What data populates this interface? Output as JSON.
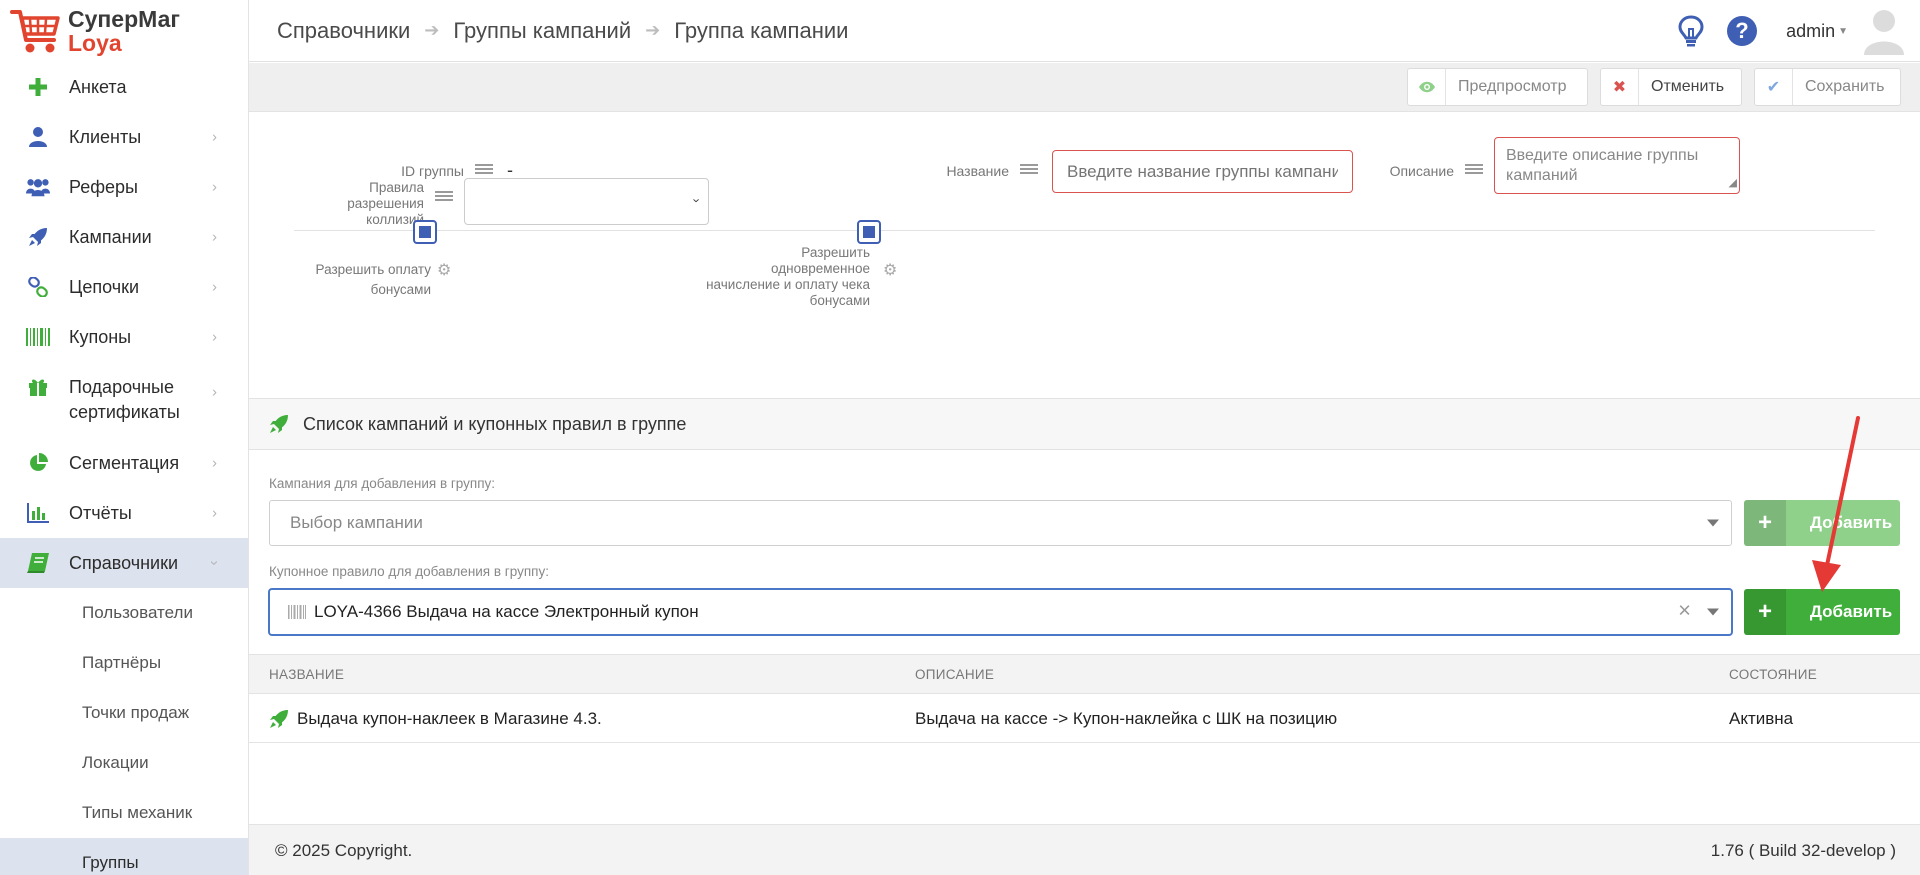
{
  "app": {
    "title": "СуперМаг",
    "subtitle": "Loya"
  },
  "sidebar": {
    "items": [
      {
        "label": "Анкета",
        "icon": "plus-icon"
      },
      {
        "label": "Клиенты",
        "icon": "user-icon"
      },
      {
        "label": "Реферы",
        "icon": "users-icon"
      },
      {
        "label": "Кампании",
        "icon": "rocket-icon"
      },
      {
        "label": "Цепочки",
        "icon": "link-icon"
      },
      {
        "label": "Купоны",
        "icon": "barcode-icon"
      },
      {
        "label": "Подарочные сертификаты",
        "icon": "gift-icon"
      },
      {
        "label": "Сегментация",
        "icon": "pie-chart-icon"
      },
      {
        "label": "Отчёты",
        "icon": "bar-chart-icon"
      },
      {
        "label": "Справочники",
        "icon": "book-icon"
      }
    ],
    "sub_items": [
      {
        "label": "Пользователи"
      },
      {
        "label": "Партнёры"
      },
      {
        "label": "Точки продаж"
      },
      {
        "label": "Локации"
      },
      {
        "label": "Типы механик"
      },
      {
        "label": "Группы"
      }
    ]
  },
  "breadcrumb": [
    "Справочники",
    "Группы кампаний",
    "Группа кампании"
  ],
  "header": {
    "user": "admin"
  },
  "toolbar": {
    "preview_label": "Предпросмотр",
    "cancel_label": "Отменить",
    "save_label": "Сохранить"
  },
  "form": {
    "group_id_label": "ID группы",
    "group_id_value": "-",
    "name_label": "Название",
    "name_placeholder": "Введите название группы кампаний",
    "description_label": "Описание",
    "description_placeholder": "Введите описание группы кампаний",
    "collision_label": "Правила разрешения коллизий",
    "allow_bonus_label": "Разрешить оплату бонусами",
    "allow_simultaneous_label": "Разрешить одновременное начисление и оплату чека бонусами"
  },
  "section": {
    "title": "Список кампаний и купонных правил в группе",
    "campaign_label": "Кампания для добавления в группу:",
    "campaign_placeholder": "Выбор кампании",
    "coupon_label": "Купонное правило для добавления в группу:",
    "coupon_value": "LOYA-4366 Выдача на кассе Электронный купон",
    "add_label": "Добавить"
  },
  "table": {
    "headers": [
      "НАЗВАНИЕ",
      "ОПИСАНИЕ",
      "СОСТОЯНИЕ"
    ],
    "rows": [
      {
        "name": "Выдача купон-наклеек в Магазине 4.3.",
        "description": "Выдача на кассе -> Купон-наклейка с ШК на позицию",
        "status": "Активна"
      }
    ]
  },
  "footer": {
    "copyright": "© 2025 Copyright.",
    "version": "1.76 ( Build 32-develop )"
  },
  "colors": {
    "accent_blue": "#3f5fb5",
    "green": "#3fae3a",
    "red": "#d9534f",
    "annotation": "#e53935"
  }
}
